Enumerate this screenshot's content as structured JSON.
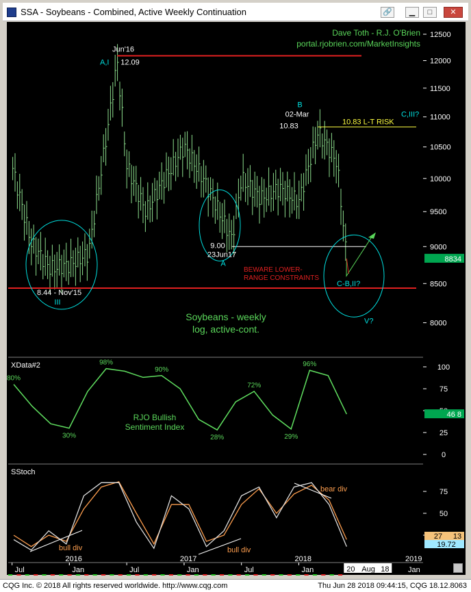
{
  "window": {
    "title": "SSA - Soybeans - Combined, Active Weekly Continuation",
    "close_label": "✕"
  },
  "status": {
    "copyright": "CQG Inc. © 2018 All rights reserved worldwide. http://www.cqg.com",
    "timestamp": "Thu Jun 28 2018 09:44:15, CQG 18.12.8063"
  },
  "colors": {
    "background": "#000000",
    "price_bars": "#8ee08e",
    "resistance_line": "#e02020",
    "support_line": "#ffffff",
    "wave_labels": "#00e0e0",
    "text_green": "#5ad65a",
    "text_yellow": "#ffff40",
    "stoch_k": "#e0e0e0",
    "stoch_d": "#ff9f4f",
    "sentiment_line": "#60e060",
    "last_price_box": "#00a650"
  },
  "chart_data": [
    {
      "type": "line",
      "panel": "price",
      "title": "Soybeans - weekly\nlog, active-cont.",
      "author": "Dave Toth - R.J. O'Brien",
      "website": "portal.rjobrien.com/MarketInsights",
      "scale": "log",
      "ylim": [
        7600,
        12700
      ],
      "y_ticks": [
        "12500",
        "12000",
        "11500",
        "11000",
        "10500",
        "10000",
        "9500",
        "9000",
        "8500",
        "8000"
      ],
      "last_price": "8834",
      "x_labels": [
        "Jul",
        "2016",
        "Jan",
        "Jul",
        "2017",
        "Jan",
        "Jul",
        "2018",
        "Jan",
        "20",
        "Aug",
        "18",
        "2019",
        "Jan"
      ],
      "x": [
        "2015-07",
        "2015-09",
        "2015-11",
        "2016-01",
        "2016-03",
        "2016-05",
        "2016-06",
        "2016-07",
        "2016-09",
        "2016-11",
        "2017-01",
        "2017-03",
        "2017-05",
        "2017-06",
        "2017-07",
        "2017-09",
        "2017-11",
        "2018-01",
        "2018-03",
        "2018-04",
        "2018-05",
        "2018-06"
      ],
      "series": [
        {
          "values": [
            10200,
            9050,
            8700,
            8750,
            8900,
            10800,
            12000,
            10200,
            9500,
            10000,
            10500,
            10000,
            9400,
            9100,
            10000,
            9700,
            9850,
            9650,
            10750,
            10500,
            10250,
            8834
          ]
        }
      ],
      "annotations": [
        {
          "label": "Jun'16",
          "value": "12.09",
          "wave": "A,I"
        },
        {
          "label": "02-Mar",
          "value": "10.83",
          "wave": "B"
        },
        {
          "label": "23Jun17",
          "value": "9.00",
          "wave": "A"
        },
        {
          "label": "8.44 - Nov'15",
          "wave": "III"
        },
        {
          "label": "10.83 L-T RISK"
        },
        {
          "label": "BEWARE LOWER-\nRANGE CONSTRAINTS"
        },
        {
          "label": "C,III?"
        },
        {
          "label": "C-B,II?"
        },
        {
          "label": "V?"
        }
      ]
    },
    {
      "type": "line",
      "panel": "sentiment",
      "title": "XData#2",
      "label": "RJO Bullish\nSentiment Index",
      "ylim": [
        0,
        100
      ],
      "y_ticks": [
        "100",
        "75",
        "50",
        "25",
        "0"
      ],
      "last_value": "46 8",
      "values": [
        80,
        55,
        35,
        30,
        72,
        98,
        95,
        88,
        90,
        75,
        40,
        28,
        60,
        72,
        45,
        29,
        96,
        90,
        46
      ],
      "point_labels": [
        "80%",
        "98%",
        "90%",
        "30%",
        "28%",
        "72%",
        "29%",
        "96%"
      ]
    },
    {
      "type": "line",
      "panel": "stochastic",
      "title": "SStoch",
      "y_ticks": [
        "75",
        "50",
        "25"
      ],
      "last_values": [
        "27",
        "13",
        "19.72"
      ],
      "k": [
        20,
        8,
        30,
        15,
        70,
        85,
        85,
        40,
        10,
        70,
        55,
        12,
        30,
        70,
        80,
        45,
        80,
        85,
        60,
        12
      ],
      "d": [
        25,
        12,
        25,
        18,
        55,
        80,
        86,
        50,
        15,
        60,
        60,
        18,
        25,
        60,
        78,
        50,
        72,
        82,
        65,
        20
      ],
      "annotations": [
        "bull div",
        "bull div",
        "bear div"
      ]
    }
  ]
}
